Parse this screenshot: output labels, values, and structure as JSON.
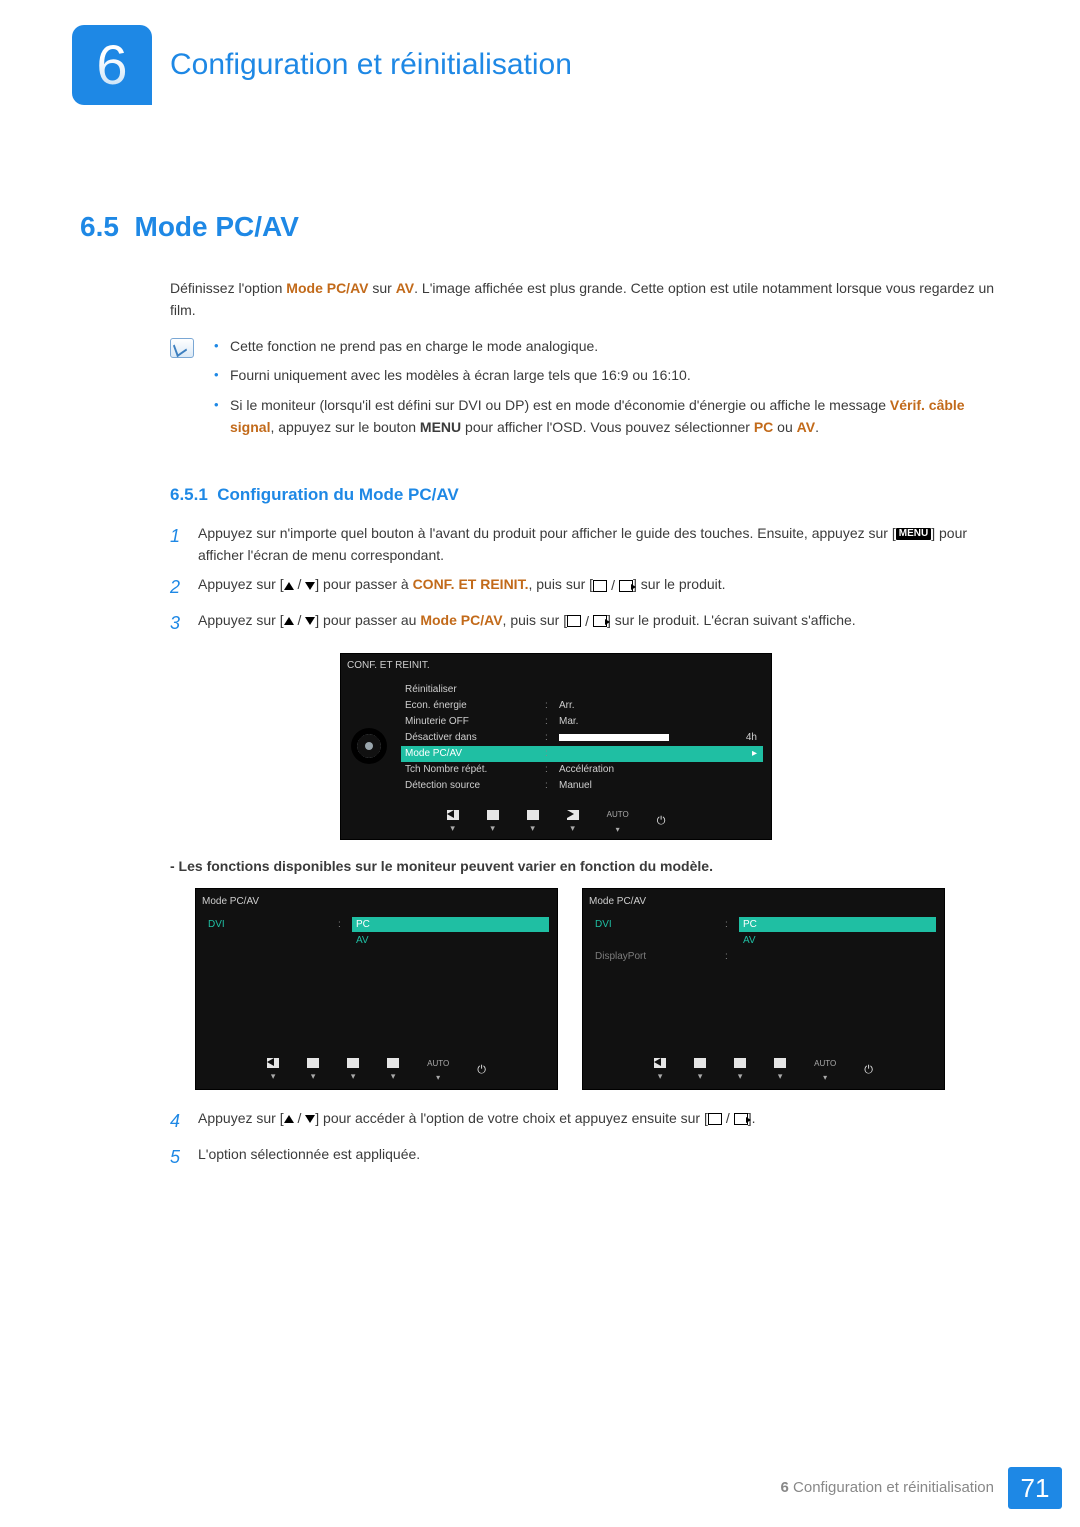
{
  "chapter": {
    "number": "6",
    "title": "Configuration et réinitialisation"
  },
  "section": {
    "number": "6.5",
    "title": "Mode PC/AV"
  },
  "intro": {
    "pre": "Définissez l'option ",
    "mode_label": "Mode PC/AV",
    "mid1": " sur ",
    "av_label": "AV",
    "post": ". L'image affichée est plus grande. Cette option est utile notamment lorsque vous regardez un film."
  },
  "notes": {
    "b1": "Cette fonction ne prend pas en charge le mode analogique.",
    "b2": "Fourni uniquement avec les modèles à écran large tels que 16:9 ou 16:10.",
    "b3_pre": "Si le moniteur (lorsqu'il est défini sur DVI ou DP) est en mode d'économie d'énergie ou affiche le message ",
    "b3_hl1": "Vérif. câble signal",
    "b3_mid1": ", appuyez sur le bouton ",
    "b3_bold": "MENU",
    "b3_mid2": " pour afficher l'OSD. Vous pouvez sélectionner ",
    "b3_hl2": "PC",
    "b3_or": " ou ",
    "b3_hl3": "AV",
    "b3_end": "."
  },
  "subsection": {
    "number": "6.5.1",
    "title": "Configuration du Mode PC/AV"
  },
  "steps": {
    "s1_a": "Appuyez sur n'importe quel bouton à l'avant du produit pour afficher le guide des touches. Ensuite, appuyez sur [",
    "s1_b": "] pour afficher l'écran de menu correspondant.",
    "s2_a": "Appuyez sur [",
    "s2_b": "] pour passer à ",
    "s2_hl": "CONF. ET REINIT.",
    "s2_c": ", puis sur [",
    "s2_d": "] sur le produit.",
    "s3_a": "Appuyez sur [",
    "s3_b": "] pour passer au ",
    "s3_hl": "Mode PC/AV",
    "s3_c": ", puis sur [",
    "s3_d": "] sur le produit. L'écran suivant s'affiche.",
    "s4_a": "Appuyez sur [",
    "s4_b": "] pour accéder à l'option de votre choix et appuyez ensuite sur [",
    "s4_c": "].",
    "s5": "L'option sélectionnée est appliquée."
  },
  "caption": "- Les fonctions disponibles sur le moniteur peuvent varier en fonction du modèle.",
  "osd_main": {
    "title": "CONF. ET REINIT.",
    "rows": [
      {
        "label": "Réinitialiser",
        "value": ""
      },
      {
        "label": "Econ. énergie",
        "value": "Arr."
      },
      {
        "label": "Minuterie OFF",
        "value": "Mar."
      },
      {
        "label": "Désactiver dans",
        "value_bar_right": "4h"
      },
      {
        "label": "Mode PC/AV",
        "value": "",
        "highlight": true,
        "arrow": true
      },
      {
        "label": "Tch Nombre répét.",
        "value": "Accélération"
      },
      {
        "label": "Détection source",
        "value": "Manuel"
      }
    ],
    "auto_label": "AUTO"
  },
  "osd_left": {
    "title": "Mode PC/AV",
    "source": "DVI",
    "opts": [
      "PC",
      "AV"
    ],
    "auto_label": "AUTO"
  },
  "osd_right": {
    "title": "Mode PC/AV",
    "sources": [
      "DVI",
      "DisplayPort"
    ],
    "opts": [
      "PC",
      "AV"
    ],
    "auto_label": "AUTO"
  },
  "footer": {
    "text_prefix": "6",
    "text": " Configuration et réinitialisation",
    "page": "71"
  }
}
